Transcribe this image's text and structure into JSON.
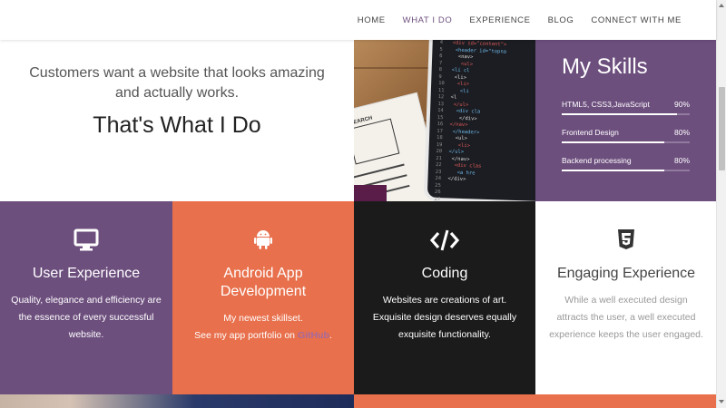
{
  "nav": {
    "items": [
      {
        "label": "HOME",
        "active": false
      },
      {
        "label": "WHAT I DO",
        "active": true
      },
      {
        "label": "EXPERIENCE",
        "active": false
      },
      {
        "label": "BLOG",
        "active": false
      },
      {
        "label": "CONNECT WITH ME",
        "active": false
      }
    ]
  },
  "hero": {
    "subtitle": "Customers want a website that looks amazing and actually works.",
    "title": "That's What I Do"
  },
  "code_image": {
    "line_numbers": "4\n5\n6\n7\n8\n9\n10\n11\n12\n13\n14\n15\n16\n17\n18\n19\n20\n21\n22\n23\n24\n25\n26\n27",
    "code_lines": [
      "<div id=\"content\">",
      "<header id=\"topna",
      "<nav>",
      "<ul>",
      "<li cl",
      "<li>",
      "<li>",
      "<li",
      "<l",
      "</ul>",
      "<div cla",
      "</div>",
      "</nav>",
      "</header>",
      "<ul>",
      "<li>",
      "</ul>",
      "</nav>",
      "<div clas",
      "<a hre",
      "</div>"
    ],
    "sketch_label": "SEARCH"
  },
  "skills": {
    "title": "My Skills",
    "items": [
      {
        "name": "HTML5, CSS3,JavaScript",
        "percent_label": "90%",
        "level": 0.9
      },
      {
        "name": "Frontend Design",
        "percent_label": "80%",
        "level": 0.8
      },
      {
        "name": "Backend processing",
        "percent_label": "80%",
        "level": 0.8
      }
    ]
  },
  "services": [
    {
      "title": "User Experience",
      "description": "Quality, elegance and efficiency are the essence of every successful website.",
      "icon": "monitor-icon"
    },
    {
      "title": "Android App Development",
      "description_line1": "My newest skillset.",
      "description_line2_prefix": "See my app portfolio on ",
      "link_text": "GitHub",
      "description_suffix": ".",
      "icon": "android-icon"
    },
    {
      "title": "Coding",
      "description": "Websites are creations of art. Exquisite design deserves equally exquisite functionality.",
      "icon": "code-icon"
    },
    {
      "title": "Engaging Experience",
      "description": "While a well executed design attracts the user, a well executed experience keeps the user engaged.",
      "icon": "html5-icon"
    }
  ],
  "colors": {
    "purple": "#6d4f7e",
    "orange": "#e8704c",
    "dark": "#1b1b1b",
    "white": "#ffffff"
  }
}
